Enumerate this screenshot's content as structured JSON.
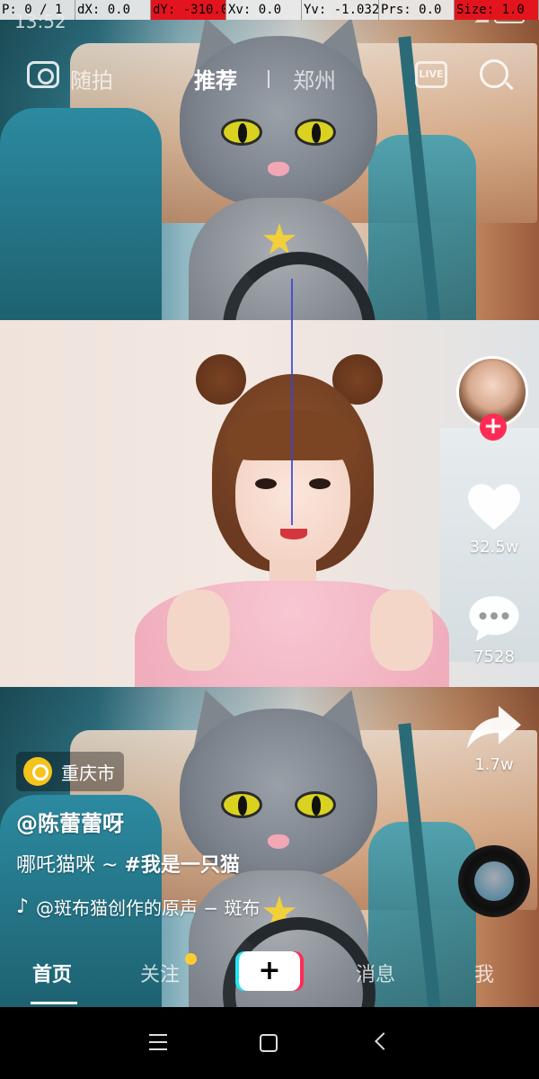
{
  "debug": {
    "pointer": "P: 0 / 1",
    "dx": "dX: 0.0",
    "dy": "dY: -310.0",
    "xv": "Xv: 0.0",
    "yv": "Yv: -1.032",
    "prs": "Prs: 0.0",
    "size": "Size: 1.0"
  },
  "status": {
    "time": "13:52"
  },
  "topnav": {
    "camera_label": "随拍",
    "recommend": "推荐",
    "city": "郑州",
    "live_label": "LIVE"
  },
  "actions": {
    "likes": "32.5w",
    "comments": "7528",
    "shares": "1.7w"
  },
  "caption": {
    "location": "重庆市",
    "author": "@陈蕾蕾呀",
    "text": "哪吒猫咪 ~ ",
    "hashtag": "#我是一只猫",
    "music": "@斑布猫创作的原声 − 斑布"
  },
  "tabs": {
    "home": "首页",
    "follow": "关注",
    "create": "+",
    "messages": "消息",
    "me": "我"
  },
  "colors": {
    "accent_red": "#fe2c55",
    "accent_cyan": "#24e6f4",
    "notification_dot": "#fccd32",
    "location_pin": "#f4c31c"
  }
}
